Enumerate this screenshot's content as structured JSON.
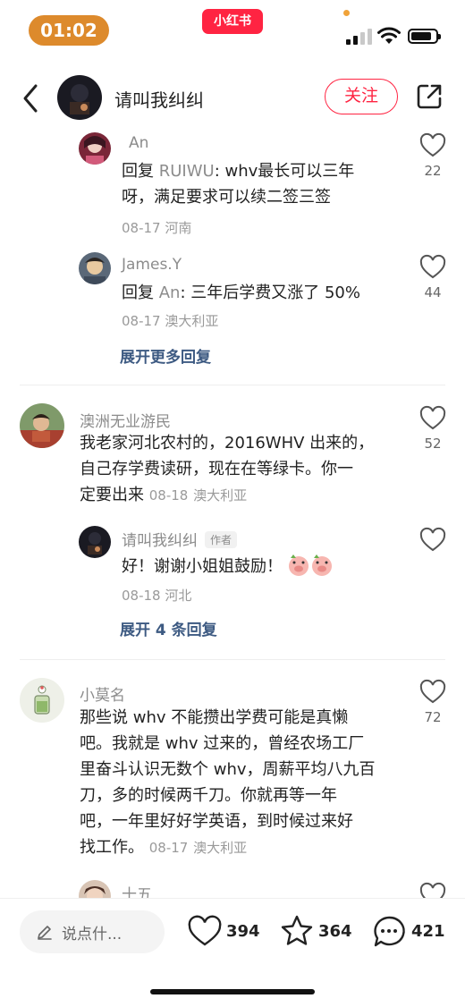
{
  "status": {
    "time": "01:02",
    "brand": "小红书",
    "accent_color": "#ff2442",
    "time_pill_color": "#dd8a2c"
  },
  "header": {
    "author_name": "请叫我纠纠",
    "follow_label": "关注",
    "back_icon": "chevron-left-icon",
    "share_icon": "share-icon"
  },
  "comments": {
    "reply1": {
      "name": "An",
      "prefix": "回复 ",
      "mention": "RUIWU",
      "text": ": whv最长可以三年呀，满足要求可以续二签三签",
      "line1": "whv最长可以三年",
      "line2": "呀，满足要求可以续二签三签",
      "date": "08-17",
      "location": "河南",
      "likes": "22"
    },
    "reply2": {
      "name": "James.Y",
      "prefix": "回复 ",
      "mention": "An",
      "text": ": 三年后学费又涨了 50%",
      "date": "08-17",
      "location": "澳大利亚",
      "likes": "44"
    },
    "expand1": "展开更多回复",
    "comment1": {
      "name": "澳洲无业游民",
      "line1": "我老家河北农村的，2016WHV 出来的，",
      "line2": "自己存学费读研，现在在等绿卡。你一",
      "line3": "定要出来",
      "date": "08-18",
      "location": "澳大利亚",
      "likes": "52"
    },
    "reply3": {
      "name": "请叫我纠纠",
      "tag": "作者",
      "text": "好！谢谢小姐姐鼓励！",
      "date": "08-18",
      "location": "河北"
    },
    "expand2": "展开 4 条回复",
    "comment2": {
      "name": "小莫名",
      "line1": "那些说 whv 不能攒出学费可能是真懒",
      "line2": "吧。我就是 whv 过来的，曾经农场工厂",
      "line3": "里奋斗认识无数个 whv，周薪平均八九百",
      "line4": "刀，多的时候两千刀。你就再等一年",
      "line5": "吧，一年里好好学英语，到时候过来好",
      "line6": "找工作。",
      "date": "08-17",
      "location": "澳大利亚",
      "likes": "72"
    },
    "comment3": {
      "name": "十五"
    }
  },
  "bottom": {
    "say_placeholder": "说点什...",
    "likes": "394",
    "stars": "364",
    "comments": "421"
  }
}
